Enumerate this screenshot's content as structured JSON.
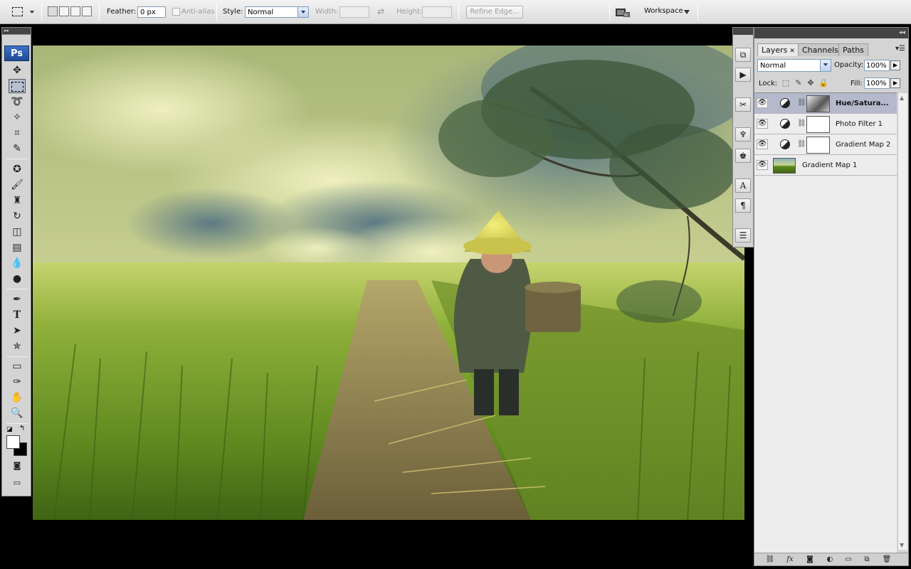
{
  "options_bar": {
    "feather_label": "Feather:",
    "feather_value": "0 px",
    "antialias_label": "Anti-alias",
    "style_label": "Style:",
    "style_value": "Normal",
    "width_label": "Width:",
    "height_label": "Height:",
    "refine_edge_label": "Refine Edge...",
    "workspace_label": "Workspace"
  },
  "toolbar": {
    "logo": "Ps",
    "text_tool_glyph": "T",
    "foreground_color": "#ffffff",
    "background_color": "#000000"
  },
  "dock": {
    "character_glyph": "A",
    "paragraph_glyph": "¶"
  },
  "layers_panel": {
    "tabs": [
      "Layers",
      "Channels",
      "Paths"
    ],
    "blend_mode": "Normal",
    "opacity_label": "Opacity:",
    "opacity_value": "100%",
    "lock_label": "Lock:",
    "fill_label": "Fill:",
    "fill_value": "100%",
    "layers": [
      {
        "name": "Hue/Satura...",
        "type": "adjustment",
        "selected": true
      },
      {
        "name": "Photo Filter 1",
        "type": "adjustment",
        "selected": false
      },
      {
        "name": "Gradient Map 2",
        "type": "adjustment",
        "selected": false
      },
      {
        "name": "Gradient Map 1",
        "type": "image",
        "selected": false
      }
    ],
    "footer_fx": "fx"
  },
  "colors": {
    "panel_bg": "#d4d4d4",
    "selected_layer": "#b5b9cc",
    "accent": "#1f4a94"
  }
}
